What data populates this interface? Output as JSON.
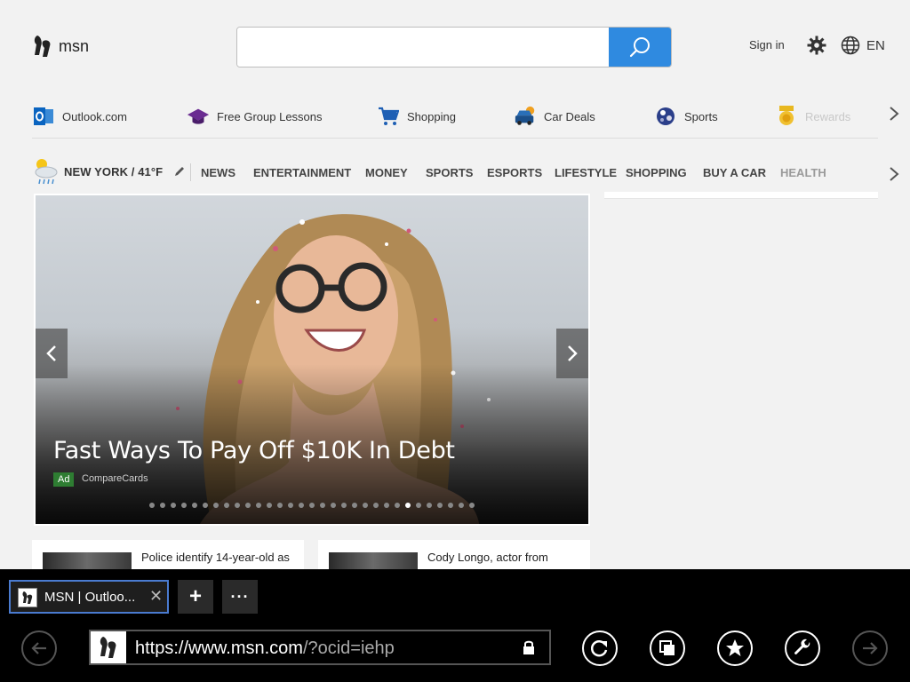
{
  "header": {
    "logo_text": "msn",
    "search_placeholder": "",
    "sign_in": "Sign in",
    "language": "EN"
  },
  "quicklinks": [
    {
      "label": "Outlook.com",
      "icon": "outlook-icon"
    },
    {
      "label": "Free Group Lessons",
      "icon": "graduation-cap-icon"
    },
    {
      "label": "Shopping",
      "icon": "shopping-cart-icon"
    },
    {
      "label": "Car Deals",
      "icon": "car-icon"
    },
    {
      "label": "Sports",
      "icon": "sports-ball-icon"
    },
    {
      "label": "Rewards",
      "icon": "medal-icon"
    }
  ],
  "weather": {
    "location_temp": "NEW YORK / 41°F"
  },
  "categories": [
    "NEWS",
    "ENTERTAINMENT",
    "MONEY",
    "SPORTS",
    "ESPORTS",
    "LIFESTYLE",
    "SHOPPING",
    "BUY A CAR",
    "HEALTH"
  ],
  "hero": {
    "title": "Fast Ways To Pay Off $10K In Debt",
    "ad_badge": "Ad",
    "source": "CompareCards",
    "dot_count": 31,
    "active_dot": 24
  },
  "cards": [
    {
      "text": "Police identify 14-year-old as"
    },
    {
      "text": "Cody Longo, actor from"
    }
  ],
  "browser": {
    "tab_title": "MSN | Outloo...",
    "tab_close": "✕",
    "new_tab": "+",
    "more_tabs": "···",
    "url_host": "https://www.msn.com",
    "url_rest": "/?ocid=iehp"
  },
  "colors": {
    "search_button": "#2f8ae0",
    "tab_border": "#4a7bd0",
    "ad_badge": "#2e7d32"
  }
}
